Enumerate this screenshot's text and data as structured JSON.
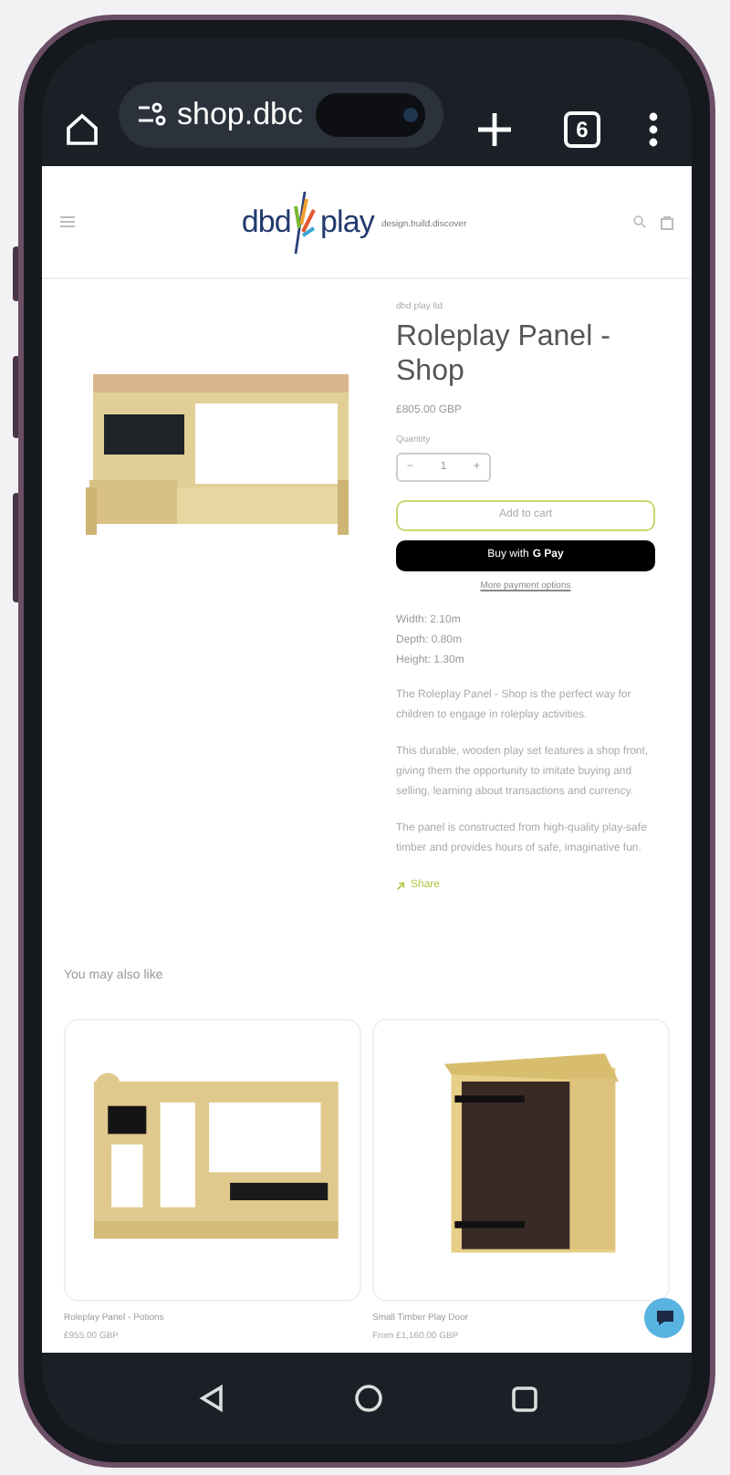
{
  "browser": {
    "url": "shop.dbc",
    "tab_count": "6"
  },
  "header": {
    "logo_left": "dbd",
    "logo_right": "play",
    "tagline": "design.build.discover"
  },
  "product": {
    "vendor": "dbd play ltd",
    "title": "Roleplay Panel - Shop",
    "price": "£805.00 GBP",
    "quantity_label": "Quantity",
    "quantity": "1",
    "decrement": "−",
    "increment": "+",
    "add_to_cart": "Add to cart",
    "buy_label": "Buy with",
    "pay_brand": "G Pay",
    "more_payment": "More payment options",
    "specs": [
      "Width: 2.10m",
      "Depth: 0.80m",
      "Height: 1.30m"
    ],
    "paragraphs": [
      "The Roleplay Panel - Shop is the perfect way for children to engage in roleplay activities.",
      "This durable, wooden play set features a shop front, giving them the opportunity to imitate buying and selling, learning about transactions and currency.",
      "The panel is constructed from high-quality play-safe timber and provides hours of safe, imaginative fun."
    ],
    "share": "Share"
  },
  "related": {
    "heading": "You may also like",
    "items": [
      {
        "kind": "panel",
        "name": "Roleplay Panel - Potions",
        "price": "£955.00 GBP"
      },
      {
        "kind": "door",
        "name": "Small Timber Play Door",
        "price": "From £1,160.00 GBP"
      }
    ]
  }
}
